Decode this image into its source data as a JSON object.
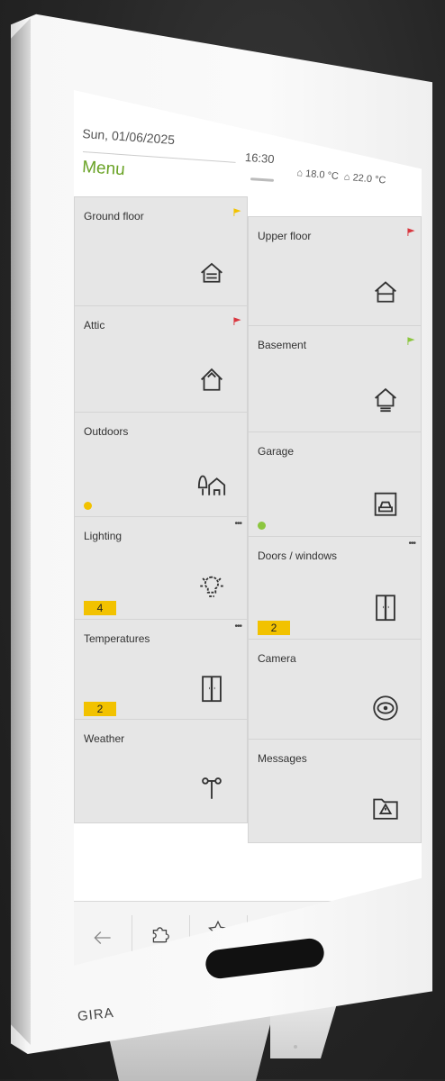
{
  "header": {
    "date": "Sun, 01/06/2025",
    "title": "Menu",
    "time": "16:30",
    "outdoor_temp": "18.0 °C",
    "indoor_temp": "22.0 °C"
  },
  "tiles": [
    {
      "label": "Ground floor",
      "icon": "house-stairs-icon",
      "indicator": "flag-yellow"
    },
    {
      "label": "Upper floor",
      "icon": "house-upper-icon",
      "indicator": "flag-red"
    },
    {
      "label": "Attic",
      "icon": "house-attic-icon",
      "indicator": "flag-red"
    },
    {
      "label": "Basement",
      "icon": "house-basement-icon",
      "indicator": "flag-green"
    },
    {
      "label": "Outdoors",
      "icon": "tree-house-icon",
      "status_dot": "#f2c200"
    },
    {
      "label": "Garage",
      "icon": "garage-icon",
      "status_dot": "#8cc63f"
    },
    {
      "label": "Lighting",
      "icon": "bulb-icon",
      "count": "4"
    },
    {
      "label": "Doors / windows",
      "icon": "door-icon",
      "count": "2"
    },
    {
      "label": "Temperatures",
      "icon": "door-icon",
      "count": "2"
    },
    {
      "label": "Camera",
      "icon": "camera-eye-icon"
    },
    {
      "label": "Weather",
      "icon": "anemometer-icon"
    },
    {
      "label": "Messages",
      "icon": "message-folder-icon"
    }
  ],
  "navbar": [
    {
      "icon": "back-arrow-icon"
    },
    {
      "icon": "puzzle-icon"
    },
    {
      "icon": "star-icon"
    },
    {
      "icon": "tree-house-icon"
    },
    {
      "icon": "garage-icon"
    },
    {
      "icon": "settings-icon"
    }
  ],
  "brand": "GIRA",
  "colors": {
    "accent": "#6aa326",
    "badge": "#f2c200",
    "tile": "#e6e6e6",
    "flag_red": "#d9363e",
    "flag_yellow": "#f2c200",
    "flag_green": "#8cc63f"
  }
}
